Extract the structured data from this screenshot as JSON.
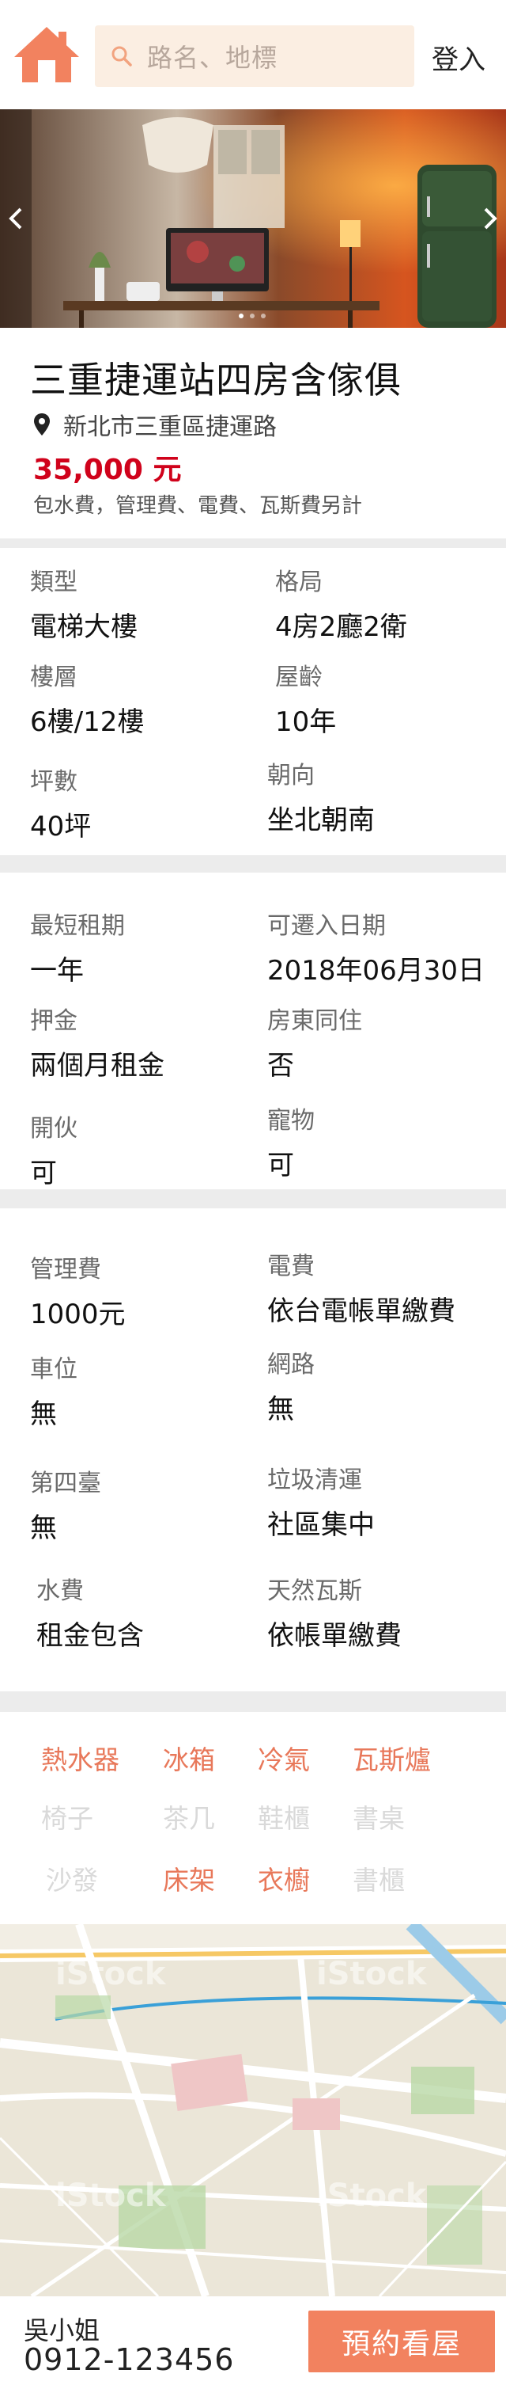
{
  "header": {
    "search_placeholder": "路名、地標",
    "login_label": "登入"
  },
  "hero": {
    "slide_count": 3,
    "active_slide": 1
  },
  "listing": {
    "title": "三重捷運站四房含傢俱",
    "address": "新北市三重區捷運路",
    "price": "35,000 元",
    "price_note": "包水費，管理費、電費、瓦斯費另計"
  },
  "basic": [
    {
      "label": "類型",
      "value": "電梯大樓"
    },
    {
      "label": "格局",
      "value": "4房2廳2衛"
    },
    {
      "label": "樓層",
      "value": "6樓/12樓"
    },
    {
      "label": "屋齡",
      "value": "10年"
    },
    {
      "label": "坪數",
      "value": "40坪"
    },
    {
      "label": "朝向",
      "value": "坐北朝南"
    }
  ],
  "rental": [
    {
      "label": "最短租期",
      "value": "一年"
    },
    {
      "label": "可遷入日期",
      "value": "2018年06月30日"
    },
    {
      "label": "押金",
      "value": "兩個月租金"
    },
    {
      "label": "房東同住",
      "value": "否"
    },
    {
      "label": "開伙",
      "value": "可"
    },
    {
      "label": "寵物",
      "value": "可"
    }
  ],
  "fees": [
    {
      "label": "管理費",
      "value": "1000元"
    },
    {
      "label": "電費",
      "value": "依台電帳單繳費"
    },
    {
      "label": "車位",
      "value": "無"
    },
    {
      "label": "網路",
      "value": "無"
    },
    {
      "label": "第四臺",
      "value": "無"
    },
    {
      "label": "垃圾清運",
      "value": "社區集中"
    },
    {
      "label": "水費",
      "value": "租金包含"
    },
    {
      "label": "天然瓦斯",
      "value": "依帳單繳費"
    }
  ],
  "amenities": [
    {
      "label": "熱水器",
      "available": true
    },
    {
      "label": "冰箱",
      "available": true
    },
    {
      "label": "冷氣",
      "available": true
    },
    {
      "label": "瓦斯爐",
      "available": true
    },
    {
      "label": "椅子",
      "available": false
    },
    {
      "label": "茶几",
      "available": false
    },
    {
      "label": "鞋櫃",
      "available": false
    },
    {
      "label": "書桌",
      "available": false
    },
    {
      "label": "沙發",
      "available": false
    },
    {
      "label": "床架",
      "available": true
    },
    {
      "label": "衣櫥",
      "available": true
    },
    {
      "label": "書櫃",
      "available": false
    }
  ],
  "map": {
    "watermark": "iStock"
  },
  "footer": {
    "contact_name": "吳小姐",
    "contact_phone": "0912-123456",
    "book_label": "預約看屋"
  },
  "colors": {
    "accent": "#f2825f",
    "price": "#d0021b",
    "amenity_on": "#e8785a",
    "amenity_off": "#d9d9d9"
  }
}
